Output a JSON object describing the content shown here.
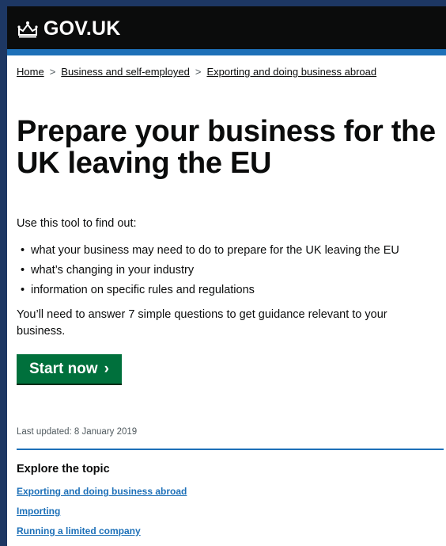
{
  "header": {
    "logo_text": "GOV.UK",
    "logo_icon": "crown-icon"
  },
  "breadcrumb": {
    "items": [
      "Home",
      "Business and self-employed",
      "Exporting and doing business abroad"
    ],
    "separator": ">"
  },
  "main": {
    "title": "Prepare your business for the UK leaving the EU",
    "intro": "Use this tool to find out:",
    "bullets": [
      "what your business may need to do to prepare for the UK leaving the EU",
      "what’s changing in your industry",
      "information on specific rules and regulations"
    ],
    "need_text": "You’ll need to answer 7 simple questions to get guidance relevant to your business.",
    "start_button": "Start now",
    "start_chevron": "›",
    "last_updated": "Last updated: 8 January 2019"
  },
  "explore": {
    "title": "Explore the topic",
    "links": [
      "Exporting and doing business abroad",
      "Importing",
      "Running a limited company"
    ]
  },
  "colors": {
    "header_bg": "#0b0c0c",
    "accent_blue": "#1d70b8",
    "button_green": "#00703c",
    "frame_border": "#1d3763"
  }
}
